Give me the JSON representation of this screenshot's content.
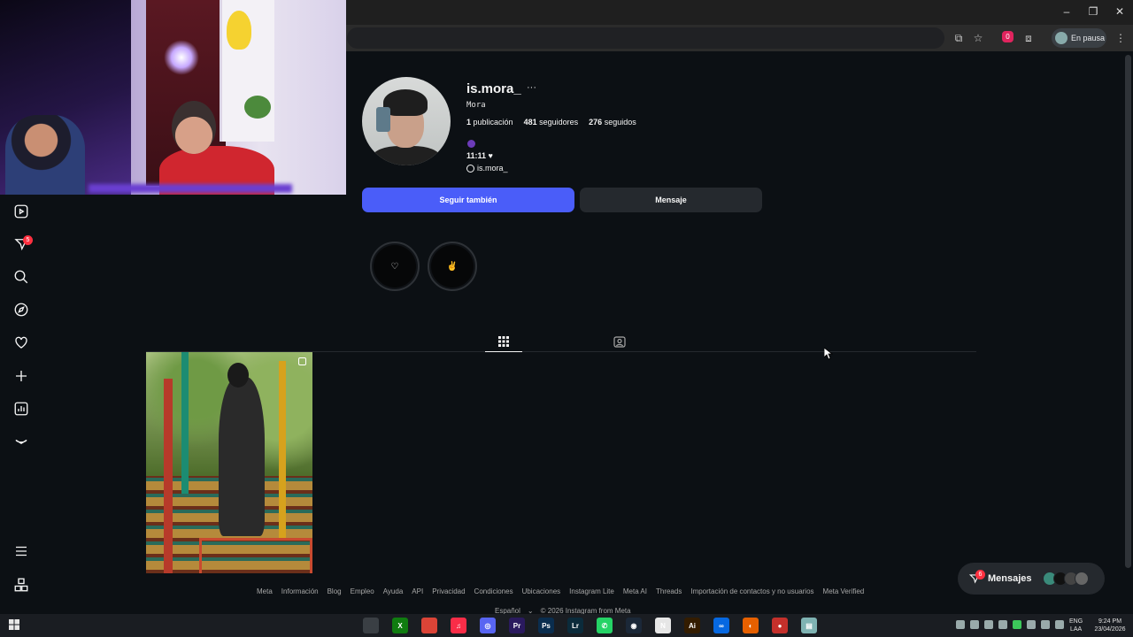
{
  "browser": {
    "profile_label": "En pausa",
    "ext_badge": "0"
  },
  "profile": {
    "username": "is.mora_",
    "more_label": "···",
    "full_name": "Mora",
    "stats": {
      "posts_count": "1",
      "posts_label": "publicación",
      "followers_count": "481",
      "followers_label": "seguidores",
      "following_count": "276",
      "following_label": "seguidos"
    },
    "bio": "11:11 ♥",
    "threads_handle": "is.mora_",
    "follow_button": "Seguir también",
    "message_button": "Mensaje",
    "highlights": [
      {
        "icon": "♡"
      },
      {
        "icon": "✌"
      }
    ]
  },
  "nav": {
    "notifications_badge": "5",
    "items": [
      "reels-icon",
      "messenger-icon",
      "search-icon",
      "explore-icon",
      "heart-icon",
      "create-icon",
      "insights-icon",
      "profile-icon",
      "menu-icon",
      "apps-icon"
    ]
  },
  "tabs": [
    "grid-icon",
    "tagged-icon"
  ],
  "footer": {
    "links": [
      "Meta",
      "Información",
      "Blog",
      "Empleo",
      "Ayuda",
      "API",
      "Privacidad",
      "Condiciones",
      "Ubicaciones",
      "Instagram Lite",
      "Meta AI",
      "Threads",
      "Importación de contactos y no usuarios",
      "Meta Verified"
    ],
    "language": "Español",
    "copyright": "© 2026 Instagram from Meta"
  },
  "messages": {
    "label": "Mensajes",
    "badge": "6"
  },
  "taskbar": {
    "lang_top": "ENG",
    "lang_bottom": "LAA",
    "time": "9:24 PM",
    "date": "23/04/2026",
    "apps": [
      {
        "label": "",
        "color": "#3a3f44"
      },
      {
        "label": "X",
        "color": "#107c10"
      },
      {
        "label": "",
        "color": "#db4437"
      },
      {
        "label": "♫",
        "color": "#fa2d48"
      },
      {
        "label": "◎",
        "color": "#5865f2"
      },
      {
        "label": "Pr",
        "color": "#2a1a5e"
      },
      {
        "label": "Ps",
        "color": "#0a2d4e"
      },
      {
        "label": "Lr",
        "color": "#0b2b3b"
      },
      {
        "label": "✆",
        "color": "#25d366"
      },
      {
        "label": "◉",
        "color": "#1b2838"
      },
      {
        "label": "N",
        "color": "#e6e6e6"
      },
      {
        "label": "Ai",
        "color": "#331c00"
      },
      {
        "label": "∞",
        "color": "#0668e1"
      },
      {
        "label": "◐",
        "color": "#e66000"
      },
      {
        "label": "●",
        "color": "#c4302b"
      },
      {
        "label": "▤",
        "color": "#7fb3b3"
      }
    ]
  }
}
